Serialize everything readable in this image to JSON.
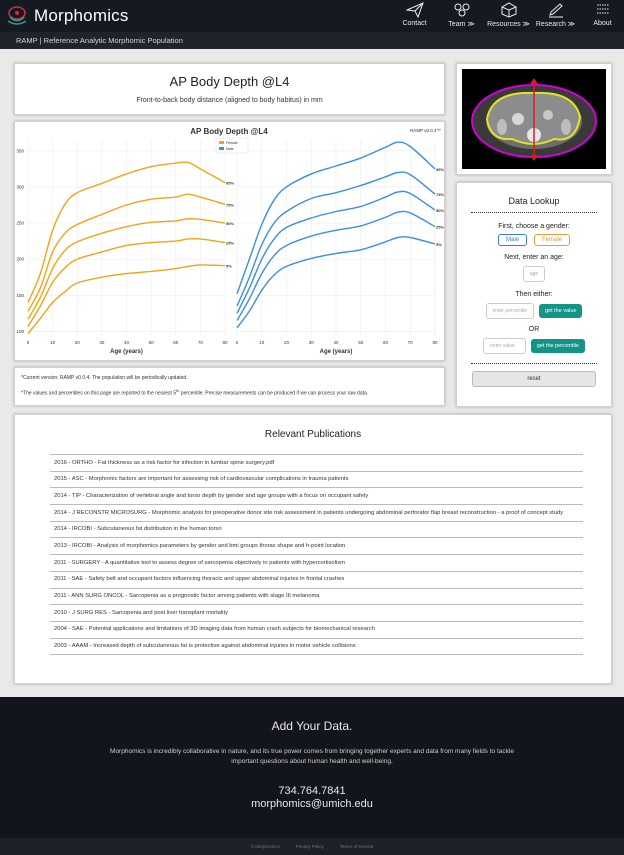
{
  "header": {
    "brand": "Morphomics",
    "nav": [
      {
        "label": "Contact",
        "icon": "paper-plane-icon"
      },
      {
        "label": "Team",
        "icon": "team-icon"
      },
      {
        "label": "Resources",
        "icon": "box-icon"
      },
      {
        "label": "Research",
        "icon": "pencil-icon"
      },
      {
        "label": "About",
        "icon": "list-icon"
      }
    ]
  },
  "subheader": "RAMP | Reference Analytic Morphomic Population",
  "page": {
    "title": "AP Body Depth @L4",
    "subtitle": "Front-to-back body distance (aligned to body habitus) in mm"
  },
  "chart_data": {
    "type": "line",
    "title": "AP Body Depth @L4",
    "version_label": "RAMP v0.0.4™",
    "legend": [
      "Female",
      "Male"
    ],
    "legend_placement": "top-center",
    "xlabel": "Age (years)",
    "ylim": [
      95,
      365
    ],
    "yticks": [
      100,
      150,
      200,
      250,
      300,
      350
    ],
    "xticks": [
      0,
      10,
      20,
      30,
      40,
      50,
      60,
      70,
      80
    ],
    "grid": true,
    "colors": {
      "female": "#f5a316",
      "male": "#3b8fe0"
    },
    "percentile_labels": [
      "95%",
      "75%",
      "50%",
      "25%",
      "5%"
    ],
    "female_series": [
      {
        "name": "95%",
        "x": [
          0,
          5,
          10,
          15,
          20,
          30,
          40,
          50,
          60,
          65,
          70,
          80
        ],
        "y": [
          140,
          180,
          240,
          276,
          292,
          305,
          318,
          328,
          333,
          334,
          325,
          306
        ]
      },
      {
        "name": "75%",
        "x": [
          0,
          5,
          10,
          15,
          20,
          30,
          40,
          50,
          60,
          65,
          70,
          80
        ],
        "y": [
          128,
          160,
          210,
          236,
          248,
          262,
          275,
          283,
          286,
          290,
          286,
          276
        ]
      },
      {
        "name": "50%",
        "x": [
          0,
          5,
          10,
          15,
          20,
          30,
          40,
          50,
          60,
          65,
          70,
          80
        ],
        "y": [
          117,
          147,
          187,
          212,
          224,
          236,
          245,
          251,
          253,
          256,
          255,
          250
        ]
      },
      {
        "name": "25%",
        "x": [
          0,
          5,
          10,
          15,
          20,
          30,
          40,
          50,
          60,
          65,
          70,
          80
        ],
        "y": [
          107,
          135,
          168,
          188,
          200,
          210,
          219,
          223,
          225,
          228,
          228,
          223
        ]
      },
      {
        "name": "5%",
        "x": [
          0,
          5,
          10,
          15,
          20,
          30,
          40,
          50,
          60,
          65,
          70,
          80
        ],
        "y": [
          97,
          118,
          140,
          155,
          167,
          175,
          180,
          183,
          187,
          190,
          192,
          191
        ]
      }
    ],
    "male_series": [
      {
        "name": "95%",
        "x": [
          0,
          5,
          10,
          15,
          20,
          30,
          40,
          50,
          60,
          65,
          70,
          80
        ],
        "y": [
          152,
          200,
          248,
          282,
          300,
          318,
          329,
          340,
          355,
          362,
          356,
          325
        ]
      },
      {
        "name": "75%",
        "x": [
          0,
          5,
          10,
          15,
          20,
          30,
          40,
          50,
          60,
          65,
          70,
          80
        ],
        "y": [
          135,
          175,
          220,
          250,
          266,
          284,
          292,
          302,
          314,
          320,
          317,
          290
        ]
      },
      {
        "name": "50%",
        "x": [
          0,
          5,
          10,
          15,
          20,
          30,
          40,
          50,
          60,
          65,
          70,
          80
        ],
        "y": [
          125,
          160,
          200,
          228,
          244,
          257,
          266,
          273,
          286,
          293,
          291,
          268
        ]
      },
      {
        "name": "25%",
        "x": [
          0,
          5,
          10,
          15,
          20,
          30,
          40,
          50,
          60,
          65,
          70,
          80
        ],
        "y": [
          115,
          145,
          180,
          205,
          219,
          232,
          240,
          246,
          258,
          265,
          264,
          245
        ]
      },
      {
        "name": "5%",
        "x": [
          0,
          5,
          10,
          15,
          20,
          30,
          40,
          50,
          60,
          65,
          70,
          80
        ],
        "y": [
          105,
          128,
          157,
          178,
          190,
          201,
          208,
          213,
          224,
          230,
          230,
          221
        ]
      }
    ]
  },
  "notes": {
    "line1": "*Current version: RAMP v0.0.4. The population will be periodically updated.",
    "line2_a": "*The values and percentiles on this page are reported to the nearest 5",
    "line2_sup": "th",
    "line2_b": " percentile. Precise measurements can be produced if we can process your raw data."
  },
  "lookup": {
    "title": "Data Lookup",
    "gender_prompt": "First, choose a gender:",
    "male": "Male",
    "female": "Female",
    "age_prompt": "Next, enter an age:",
    "age_placeholder": "age",
    "either": "Then either:",
    "percentile_placeholder": "enter percentile",
    "get_value": "get the value",
    "or": "OR",
    "value_placeholder": "enter value",
    "get_percentile": "get the percentile",
    "reset": "reset"
  },
  "publications": {
    "title": "Relevant Publications",
    "items": [
      "2016 - ORTHO - Fat thickness as a risk factor for infection in lumbar spine surgery.pdf",
      "2015 - ASC - Morphomic factors are important for assessing risk of cardiovascular complications in trauma patients",
      "2014 - TIP - Characterization of vertebral angle and torso depth by gender and age groups with a focus on occupant safety",
      "2014 - J RECONSTR MICROSURG - Morphomic analysis for preoperative donor site risk assessment in patients undergoing abdominal perforator flap breast reconstruction - a proof of concept study",
      "2014 - IRCOBI - Subcutaneous fat distribution in the human torso",
      "2013 - IRCOBI - Analysis of morphomics parameters by gender and bmi groups thorax shape and h-point location",
      "2011 - SURGERY - A quantitative tool to assess degree of sarcopenia objectively in patients with hypercortisolism",
      "2011 - SAE - Safety belt and occupant factors influencing thoracic and upper abdominal injuries in frontal crashes",
      "2011 - ANN SURG ONCOL - Sarcopenia as a prognostic factor among patients with stage III melanoma",
      "2010 - J SURG RES - Sarcopenia and post liver transplant mortality",
      "2004 - SAE - Potential applications and limitations of 3D imaging data from human crash subjects for biomechanical research",
      "2003 - AAAM - Increased depth of subcutaneous fat is protective against abdominal injuries in motor vehicle collisions"
    ]
  },
  "footer": {
    "heading": "Add Your Data.",
    "blurb": "Morphomics is incredibly collaborative in nature, and its true power comes from bringing together experts and data from many fields to tackle important questions about human health and well-being.",
    "phone": "734.764.7841",
    "email": "morphomics@umich.edu",
    "copyright": "© Morphomics",
    "privacy": "Privacy Policy",
    "terms": "Terms of Service"
  }
}
